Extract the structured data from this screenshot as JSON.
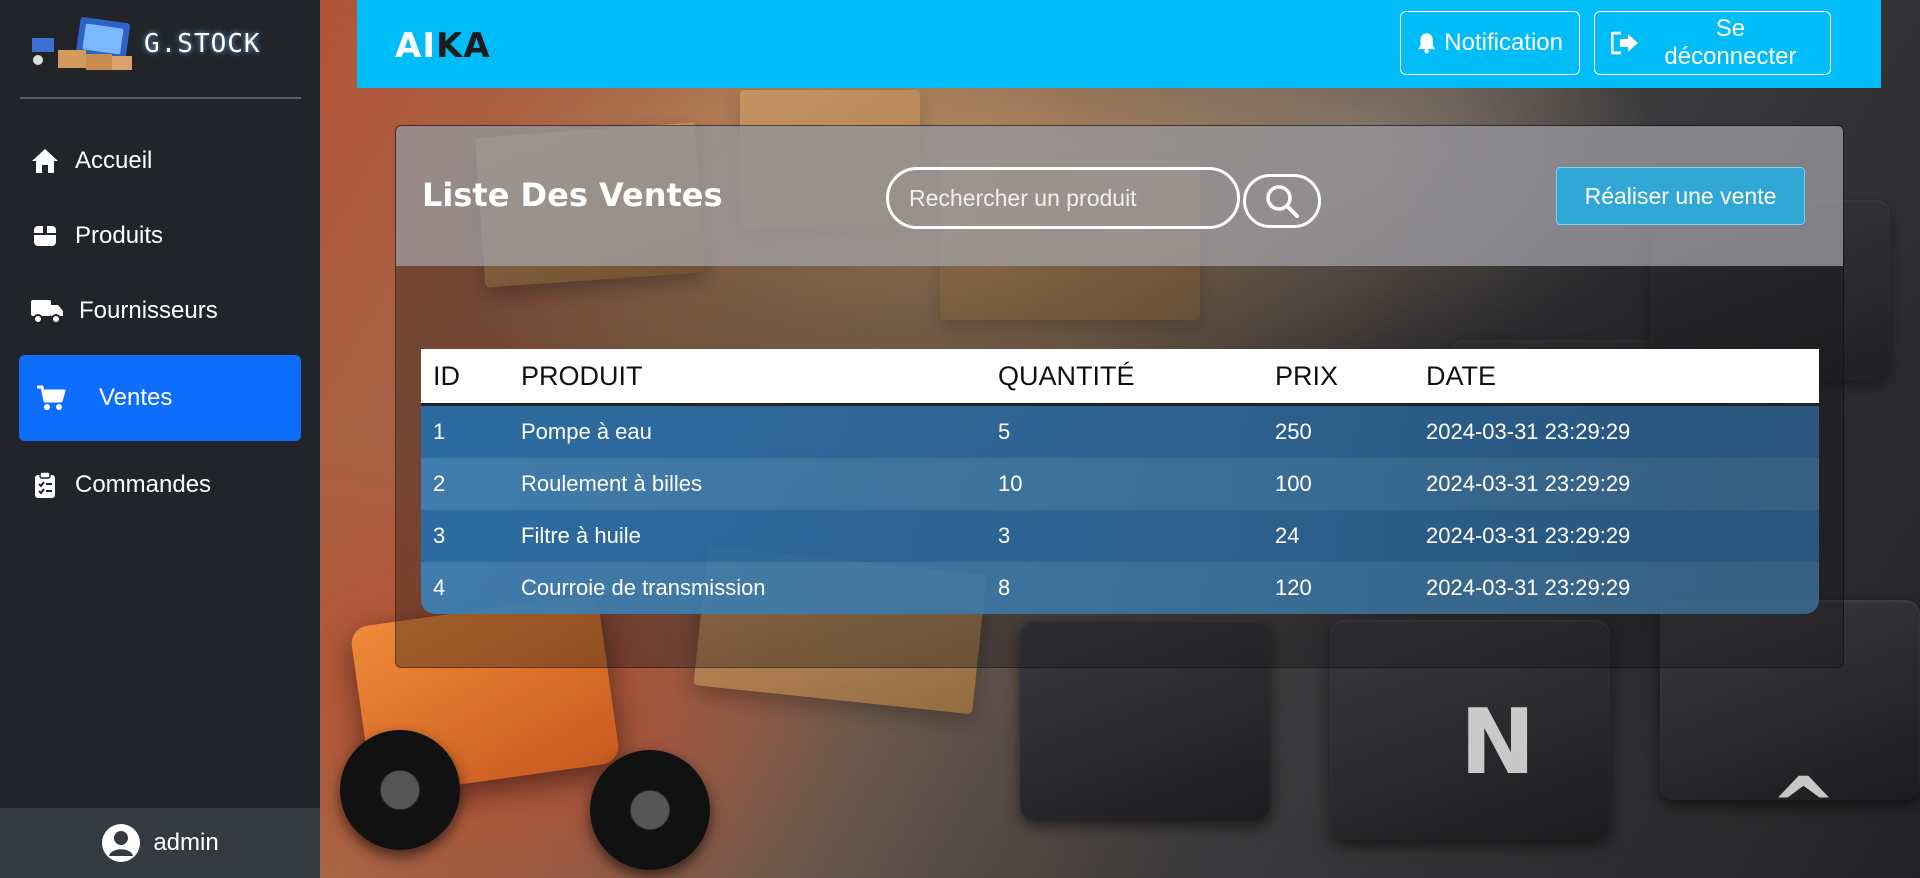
{
  "sidebar": {
    "brand": "G.STOCK",
    "items": [
      {
        "label": "Accueil",
        "icon": "home-icon",
        "active": false
      },
      {
        "label": "Produits",
        "icon": "box-icon",
        "active": false
      },
      {
        "label": "Fournisseurs",
        "icon": "truck-icon",
        "active": false
      },
      {
        "label": "Ventes",
        "icon": "cart-icon",
        "active": true
      },
      {
        "label": "Commandes",
        "icon": "clipboard-icon",
        "active": false
      }
    ],
    "user": "admin"
  },
  "header": {
    "title_part1": "AI",
    "title_part2": "KA",
    "notification_label": "Notification",
    "logout_label": "Se déconnecter"
  },
  "main": {
    "title": "Liste Des Ventes",
    "search": {
      "placeholder": "Rechercher un produit",
      "value": ""
    },
    "action_label": "Réaliser une vente",
    "table": {
      "columns": [
        "ID",
        "PRODUIT",
        "QUANTITÉ",
        "PRIX",
        "DATE"
      ],
      "rows": [
        [
          "1",
          "Pompe à eau",
          "5",
          "250",
          "2024-03-31 23:29:29"
        ],
        [
          "2",
          "Roulement à billes",
          "10",
          "100",
          "2024-03-31 23:29:29"
        ],
        [
          "3",
          "Filtre à huile",
          "3",
          "24",
          "2024-03-31 23:29:29"
        ],
        [
          "4",
          "Courroie de transmission",
          "8",
          "120",
          "2024-03-31 23:29:29"
        ]
      ]
    }
  },
  "colors": {
    "sidebar_bg": "#212529",
    "active_nav": "#0d6efd",
    "header_bg": "#00bcf9",
    "action_button": "#31a7d6"
  }
}
